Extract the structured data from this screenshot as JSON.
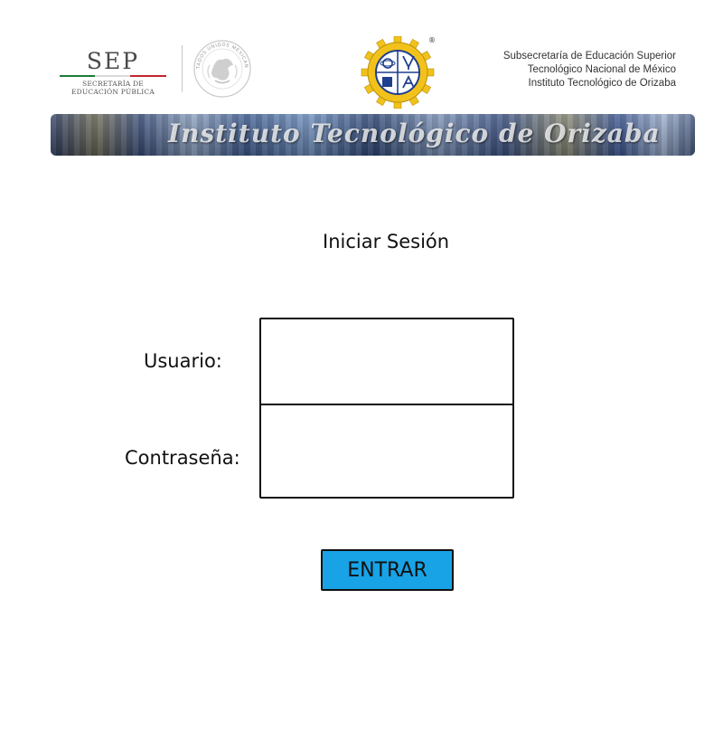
{
  "header": {
    "sep_logo": {
      "mark": "SEP",
      "subtitle_line1": "SECRETARÍA DE",
      "subtitle_line2": "EDUCACIÓN PÚBLICA"
    },
    "seal_text": "ESTADOS UNIDOS MEXICANOS",
    "emblem_mark": "®",
    "institution": {
      "line1": "Subsecretaría de Educación Superior",
      "line2": "Tecnológico Nacional de México",
      "line3": "Instituto Tecnológico de Orizaba"
    },
    "banner_text": "Instituto Tecnológico de Orizaba"
  },
  "login": {
    "title": "Iniciar Sesión",
    "user_label": "Usuario:",
    "user_value": "",
    "password_label": "Contraseña:",
    "password_value": "",
    "submit_label": "ENTRAR"
  },
  "colors": {
    "submit_button": "#18a3e6",
    "sep_green": "#1d7a3a",
    "sep_red": "#c0272d",
    "emblem_yellow": "#f2c21b",
    "emblem_blue": "#1f3f8f"
  }
}
